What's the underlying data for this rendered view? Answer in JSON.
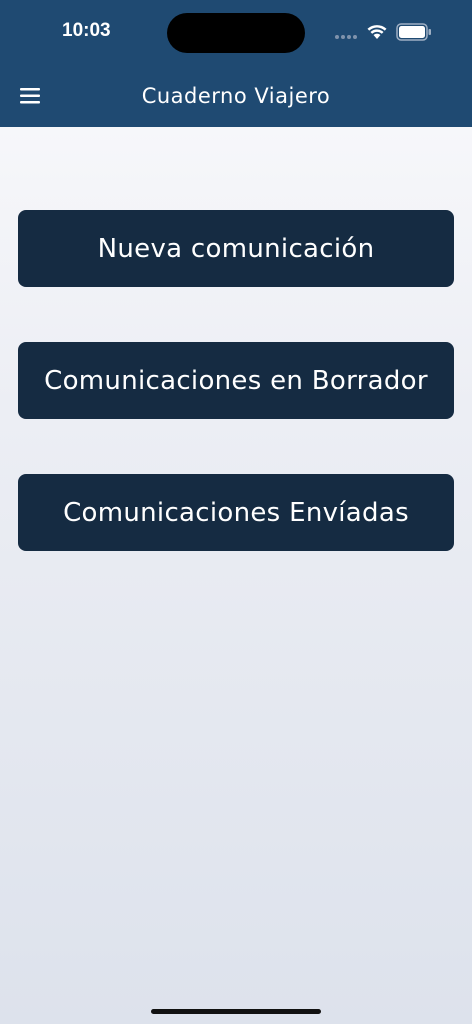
{
  "status_bar": {
    "time": "10:03"
  },
  "header": {
    "title": "Cuaderno Viajero",
    "menu_icon": "hamburger-menu-icon"
  },
  "actions": [
    {
      "label": "Nueva comunicación"
    },
    {
      "label": "Comunicaciones en Borrador"
    },
    {
      "label": "Comunicaciones Envíadas"
    }
  ],
  "colors": {
    "header_bg": "#1f4a72",
    "button_bg": "#152b42",
    "text_light": "#ffffff"
  }
}
